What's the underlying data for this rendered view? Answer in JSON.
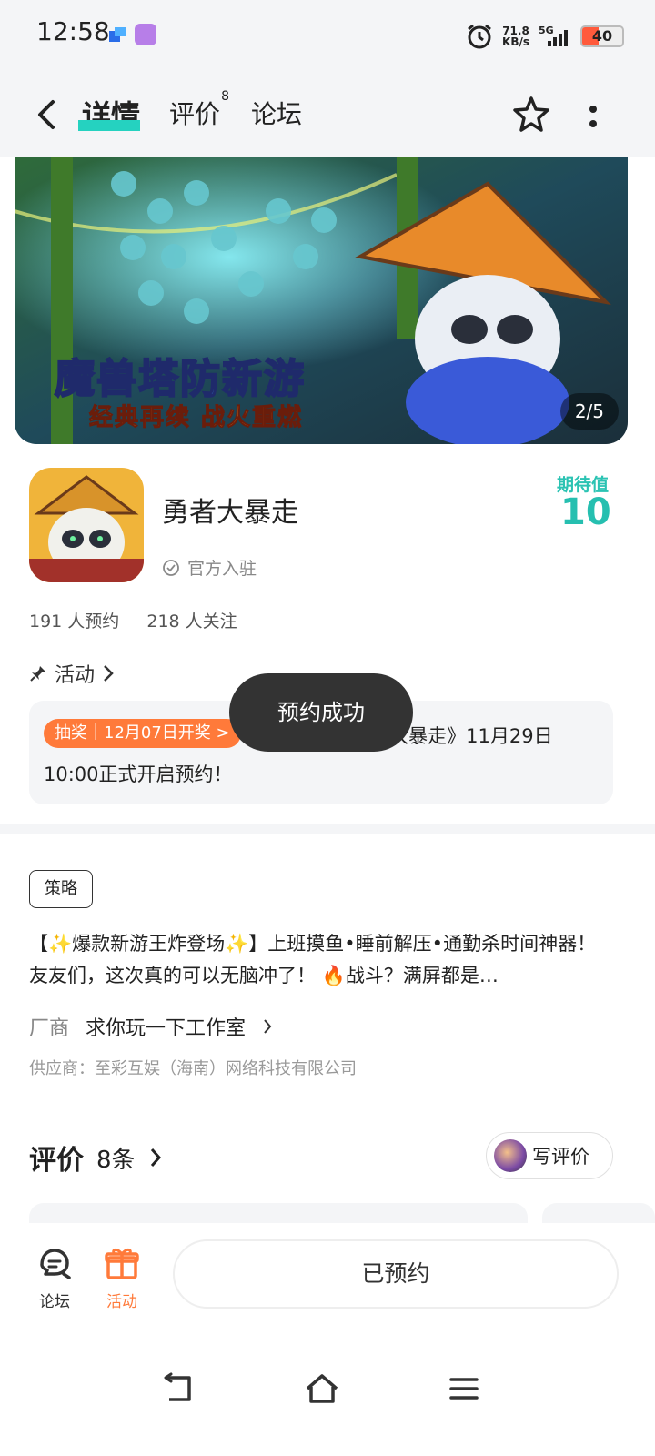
{
  "status_bar": {
    "time": "12:58",
    "net_speed_value": "71.8",
    "net_speed_unit": "KB/s",
    "network": "5G",
    "battery": "40"
  },
  "nav": {
    "tabs": [
      {
        "label": "详情",
        "active": true
      },
      {
        "label": "评价",
        "badge": "8"
      },
      {
        "label": "论坛"
      }
    ],
    "accent_color": "#25d2c0"
  },
  "banner": {
    "title": "魔兽塔防新游",
    "subtitle": "经典再续 战火重燃",
    "page_indicator": "2/5"
  },
  "game": {
    "name": "勇者大暴走",
    "verified_label": "官方入驻",
    "expect_label": "期待值",
    "expect_value": "10",
    "reservations": "191 人预约",
    "followers": "218 人关注"
  },
  "activity": {
    "header": "活动",
    "tag": "抽奖｜12月07日开奖 >",
    "text": "预约抽奖】《勇者大暴走》11月29日10:00正式开启预约！"
  },
  "toast": "预约成功",
  "strategy": {
    "tag": "策略",
    "description": "【✨爆款新游王炸登场✨】上班摸鱼•睡前解压•通勤杀时间神器！友友们，这次真的可以无脑冲了！ 🔥战斗？满屏都是…",
    "vendor_label": "厂商",
    "vendor_name": "求你玩一下工作室",
    "supplier": "供应商：至彩互娱（海南）网络科技有限公司"
  },
  "reviews": {
    "title": "评价",
    "count": "8条",
    "write_button": "写评价"
  },
  "bottom_bar": {
    "forum_label": "论坛",
    "activity_label": "活动",
    "reserve_button": "已预约",
    "activity_color": "#ff7a3a"
  }
}
